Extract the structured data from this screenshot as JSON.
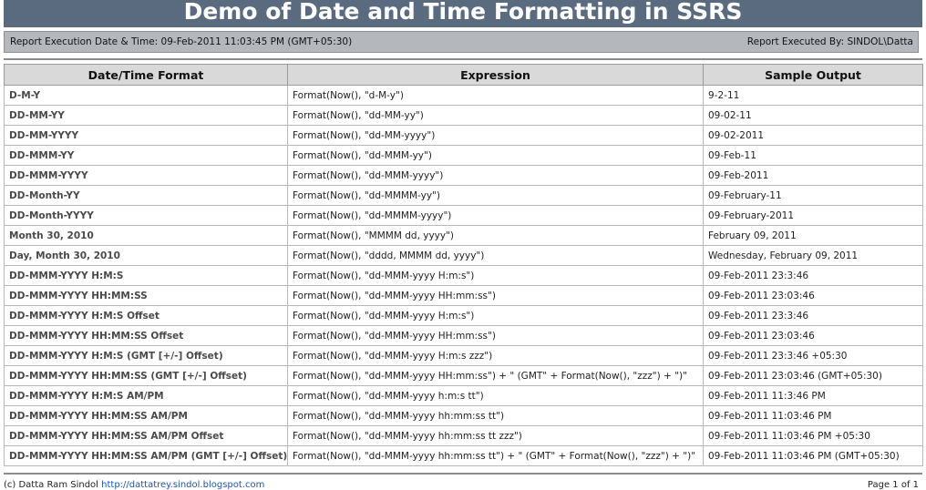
{
  "report": {
    "title": "Demo of Date and Time Formatting in SSRS",
    "execution_label": "Report Execution Date & Time: 09-Feb-2011 11:03:45 PM (GMT+05:30)",
    "executed_by_label": "Report Executed By: SINDOL\\Datta"
  },
  "table": {
    "headers": [
      "Date/Time Format",
      "Expression",
      "Sample Output"
    ],
    "rows": [
      [
        "D-M-Y",
        "Format(Now(), \"d-M-y\")",
        "9-2-11"
      ],
      [
        "DD-MM-YY",
        "Format(Now(), \"dd-MM-yy\")",
        "09-02-11"
      ],
      [
        "DD-MM-YYYY",
        "Format(Now(), \"dd-MM-yyyy\")",
        "09-02-2011"
      ],
      [
        "DD-MMM-YY",
        "Format(Now(), \"dd-MMM-yy\")",
        "09-Feb-11"
      ],
      [
        "DD-MMM-YYYY",
        "Format(Now(), \"dd-MMM-yyyy\")",
        "09-Feb-2011"
      ],
      [
        "DD-Month-YY",
        "Format(Now(), \"dd-MMMM-yy\")",
        "09-February-11"
      ],
      [
        "DD-Month-YYYY",
        "Format(Now(), \"dd-MMMM-yyyy\")",
        "09-February-2011"
      ],
      [
        "Month 30, 2010",
        "Format(Now(), \"MMMM dd, yyyy\")",
        "February 09, 2011"
      ],
      [
        "Day, Month 30, 2010",
        "Format(Now(), \"dddd, MMMM dd, yyyy\")",
        "Wednesday, February 09, 2011"
      ],
      [
        "DD-MMM-YYYY H:M:S",
        "Format(Now(), \"dd-MMM-yyyy H:m:s\")",
        "09-Feb-2011 23:3:46"
      ],
      [
        "DD-MMM-YYYY HH:MM:SS",
        "Format(Now(), \"dd-MMM-yyyy HH:mm:ss\")",
        "09-Feb-2011 23:03:46"
      ],
      [
        "DD-MMM-YYYY H:M:S Offset",
        "Format(Now(), \"dd-MMM-yyyy H:m:s\")",
        "09-Feb-2011 23:3:46"
      ],
      [
        "DD-MMM-YYYY HH:MM:SS Offset",
        "Format(Now(), \"dd-MMM-yyyy HH:mm:ss\")",
        "09-Feb-2011 23:03:46"
      ],
      [
        "DD-MMM-YYYY H:M:S (GMT [+/-] Offset)",
        "Format(Now(), \"dd-MMM-yyyy H:m:s zzz\")",
        "09-Feb-2011 23:3:46 +05:30"
      ],
      [
        "DD-MMM-YYYY HH:MM:SS (GMT [+/-] Offset)",
        "Format(Now(), \"dd-MMM-yyyy HH:mm:ss\") + \" (GMT\" + Format(Now(), \"zzz\") + \")\"",
        "09-Feb-2011 23:03:46 (GMT+05:30)"
      ],
      [
        "DD-MMM-YYYY H:M:S AM/PM",
        "Format(Now(), \"dd-MMM-yyyy h:m:s tt\")",
        "09-Feb-2011 11:3:46 PM"
      ],
      [
        "DD-MMM-YYYY HH:MM:SS AM/PM",
        "Format(Now(), \"dd-MMM-yyyy hh:mm:ss tt\")",
        "09-Feb-2011 11:03:46 PM"
      ],
      [
        "DD-MMM-YYYY HH:MM:SS AM/PM Offset",
        "Format(Now(), \"dd-MMM-yyyy hh:mm:ss tt zzz\")",
        "09-Feb-2011 11:03:46 PM +05:30"
      ],
      [
        "DD-MMM-YYYY HH:MM:SS AM/PM (GMT [+/-] Offset)",
        "Format(Now(), \"dd-MMM-yyyy hh:mm:ss tt\") + \" (GMT\" + Format(Now(), \"zzz\") + \")\"",
        "09-Feb-2011 11:03:46 PM (GMT+05:30)"
      ]
    ]
  },
  "footer": {
    "author": "(c) Datta Ram Sindol",
    "link": "http://dattatrey.sindol.blogspot.com",
    "page": "Page 1 of 1"
  },
  "colors": {
    "title_bar": "#5a6b80",
    "info_bar": "#b4b8bd",
    "header_row": "#d9d9d9"
  }
}
